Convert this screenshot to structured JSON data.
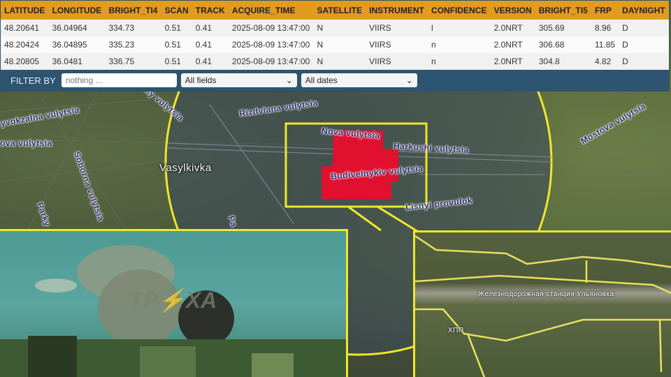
{
  "table": {
    "columns": [
      "LATITUDE",
      "LONGITUDE",
      "BRIGHT_TI4",
      "SCAN",
      "TRACK",
      "ACQUIRE_TIME",
      "SATELLITE",
      "INSTRUMENT",
      "CONFIDENCE",
      "VERSION",
      "BRIGHT_TI5",
      "FRP",
      "DAYNIGHT"
    ],
    "rows": [
      [
        "48.20641",
        "36.04964",
        "334.73",
        "0.51",
        "0.41",
        "2025-08-09 13:47:00",
        "N",
        "VIIRS",
        "l",
        "2.0NRT",
        "305.69",
        "8.96",
        "D"
      ],
      [
        "48.20424",
        "36.04895",
        "335.23",
        "0.51",
        "0.41",
        "2025-08-09 13:47:00",
        "N",
        "VIIRS",
        "n",
        "2.0NRT",
        "306.68",
        "11.85",
        "D"
      ],
      [
        "48.20805",
        "36.0481",
        "336.75",
        "0.51",
        "0.41",
        "2025-08-09 13:47:00",
        "N",
        "VIIRS",
        "n",
        "2.0NRT",
        "304.8",
        "4.82",
        "D"
      ]
    ],
    "header_color": "#e29a1f"
  },
  "filter": {
    "label": "FILTER BY",
    "placeholder": "nothing ...",
    "field_select": "All fields",
    "date_select": "All dates"
  },
  "map": {
    "labels": {
      "town": "Vasylkivka",
      "rizdviana": "Rizdviana vulytsia",
      "nova": "Nova vulytsia",
      "harkushi": "Harkushi vulytsia",
      "budivelnykiv": "Budivelnykiv vulytsia",
      "lisnyi": "Lisnyi provulok",
      "mostova": "Mostova vulytsia",
      "soborna": "Soborna vulytsia",
      "vokzalna": "yvokzalna vulytsia",
      "ova": "ova vulytsia",
      "nky": "nky vulytsia",
      "parky": "Parky",
      "pa": "Pa"
    },
    "highlight_color": "#e0102e",
    "outline_color": "#f0e62a"
  },
  "inset": {
    "station": "Железнодорожная станция Ульяновка",
    "hpp": "ХПП"
  },
  "photo": {
    "watermark": "TPXA"
  }
}
